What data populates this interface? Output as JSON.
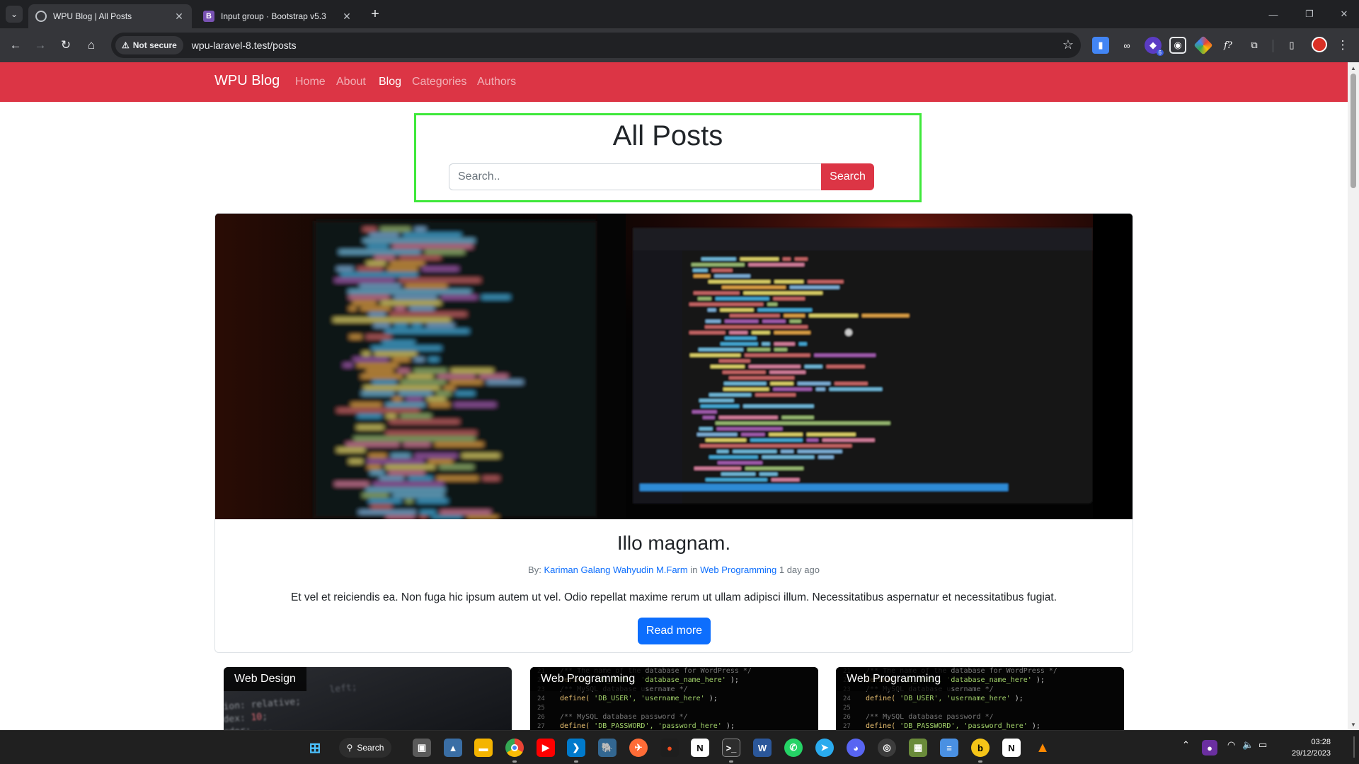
{
  "browser": {
    "tabs": [
      {
        "title": "WPU Blog | All Posts",
        "favicon": "globe-icon",
        "active": true
      },
      {
        "title": "Input group · Bootstrap v5.3",
        "favicon": "bootstrap-icon",
        "favicon_letter": "B",
        "active": false
      }
    ],
    "security_label": "Not secure",
    "url": "wpu-laravel-8.test/posts",
    "extensions": [
      {
        "name": "docs-extension-icon",
        "color": "#4285f4"
      },
      {
        "name": "glasses-extension-icon",
        "color": "#e8eaed"
      },
      {
        "name": "ublock-extension-icon",
        "color": "#5b3cc4",
        "badge": "6"
      },
      {
        "name": "shield-extension-icon",
        "color": "#e8eaed"
      },
      {
        "name": "colorpick-extension-icon",
        "color": "#34a853"
      },
      {
        "name": "fonts-extension-icon",
        "color": "#e8eaed",
        "glyph": "f?"
      },
      {
        "name": "puzzle-extension-icon",
        "color": "#e8eaed"
      }
    ]
  },
  "site": {
    "brand": "WPU Blog",
    "nav": [
      {
        "label": "Home",
        "active": false
      },
      {
        "label": "About",
        "active": false
      },
      {
        "label": "Blog",
        "active": true
      },
      {
        "label": "Categories",
        "active": false
      },
      {
        "label": "Authors",
        "active": false
      }
    ],
    "accent": "#dc3545"
  },
  "header": {
    "title": "All Posts",
    "search_placeholder": "Search..",
    "search_button": "Search"
  },
  "featured": {
    "title": "Illo magnam.",
    "by_label": "By:",
    "author": "Kariman Galang Wahyudin M.Farm",
    "in_label": "in",
    "category": "Web Programming",
    "time": "1 day ago",
    "excerpt": "Et vel et reiciendis ea. Non fuga hic ipsum autem ut vel. Odio repellat maxime rerum ut ullam adipisci illum. Necessitatibus aspernatur et necessitatibus fugiat.",
    "button": "Read more"
  },
  "cards": [
    {
      "category": "Web Design"
    },
    {
      "category": "Web Programming"
    },
    {
      "category": "Web Programming"
    }
  ],
  "taskbar": {
    "search_label": "Search",
    "time": "03:28",
    "date": "29/12/2023"
  }
}
